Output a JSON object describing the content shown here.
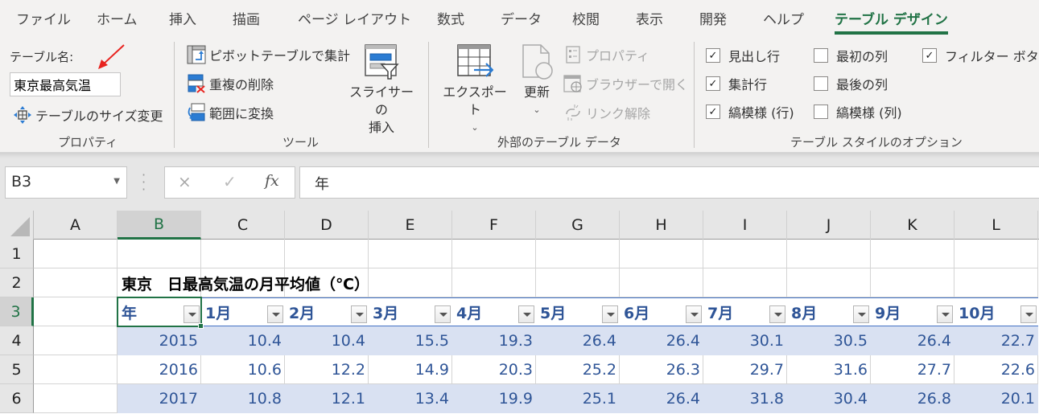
{
  "ribbon": {
    "tabs": [
      "ファイル",
      "ホーム",
      "挿入",
      "描画",
      "ページ レイアウト",
      "数式",
      "データ",
      "校閲",
      "表示",
      "開発",
      "ヘルプ",
      "テーブル デザイン"
    ],
    "active_tab": "テーブル デザイン",
    "accent_color": "#217346",
    "groups": {
      "properties": {
        "label": "プロパティ",
        "table_name_label": "テーブル名:",
        "table_name_value": "東京最高気温",
        "resize_label": "テーブルのサイズ変更"
      },
      "tools": {
        "label": "ツール",
        "pivot_label": "ピボットテーブルで集計",
        "remove_dup_label": "重複の削除",
        "convert_label": "範囲に変換",
        "slicer_label_line1": "スライサーの",
        "slicer_label_line2": "挿入"
      },
      "external": {
        "label": "外部のテーブル データ",
        "export_label": "エクスポート",
        "refresh_label": "更新",
        "properties_label": "プロパティ",
        "open_browser_label": "ブラウザーで開く",
        "unlink_label": "リンク解除"
      },
      "style_options": {
        "label": "テーブル スタイルのオプション",
        "options": [
          {
            "label": "見出し行",
            "checked": true
          },
          {
            "label": "集計行",
            "checked": true
          },
          {
            "label": "縞模様 (行)",
            "checked": true
          },
          {
            "label": "最初の列",
            "checked": false
          },
          {
            "label": "最後の列",
            "checked": false
          },
          {
            "label": "縞模様 (列)",
            "checked": false
          },
          {
            "label": "フィルター ボタン",
            "checked": true
          }
        ]
      }
    }
  },
  "formula_bar": {
    "name_box": "B3",
    "cancel_icon": "×",
    "enter_icon": "✓",
    "fx_label": "fx",
    "content": "年"
  },
  "sheet": {
    "columns": [
      "A",
      "B",
      "C",
      "D",
      "E",
      "F",
      "G",
      "H",
      "I",
      "J",
      "K",
      "L"
    ],
    "selected_column": "B",
    "rows": [
      "1",
      "2",
      "3",
      "4",
      "5",
      "6"
    ],
    "selected_row": "3",
    "title": "東京　日最高気温の月平均値（℃）",
    "table": {
      "headers": [
        "年",
        "1月",
        "2月",
        "3月",
        "4月",
        "5月",
        "6月",
        "7月",
        "8月",
        "9月",
        "10月"
      ],
      "rows": [
        [
          "2015",
          "10.4",
          "10.4",
          "15.5",
          "19.3",
          "26.4",
          "26.4",
          "30.1",
          "30.5",
          "26.4",
          "22.7"
        ],
        [
          "2016",
          "10.6",
          "12.2",
          "14.9",
          "20.3",
          "25.2",
          "26.3",
          "29.7",
          "31.6",
          "27.7",
          "22.6"
        ],
        [
          "2017",
          "10.8",
          "12.1",
          "13.4",
          "19.9",
          "25.1",
          "26.4",
          "31.8",
          "30.4",
          "26.8",
          "20.1"
        ]
      ],
      "header_color": "#2f5597",
      "band_color": "#d9e1f2"
    }
  }
}
